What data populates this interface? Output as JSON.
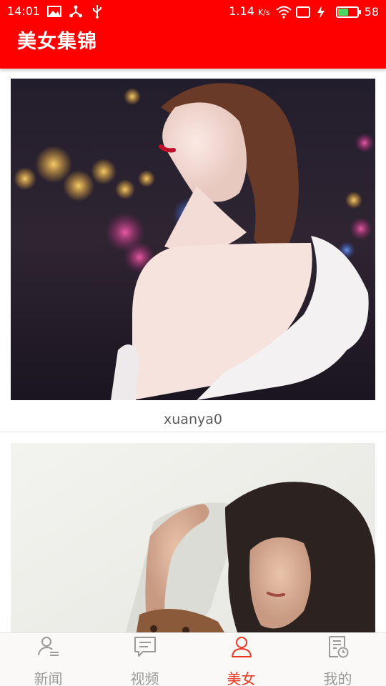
{
  "status_bar": {
    "time": "14:01",
    "net_speed": "1.14",
    "net_speed_unit": "K/s",
    "battery_level": "58",
    "battery_fraction": 0.58,
    "icons": [
      "gallery-icon",
      "usb-share-icon",
      "usb-icon",
      "wifi-icon",
      "screen-icon",
      "charging-icon",
      "battery-icon"
    ]
  },
  "app_bar": {
    "title": "美女集锦"
  },
  "feed": {
    "items": [
      {
        "caption": "xuanya0"
      },
      {
        "caption": ""
      }
    ]
  },
  "bottom_nav": {
    "items": [
      {
        "label": "新闻",
        "icon": "user-list-icon"
      },
      {
        "label": "视频",
        "icon": "chat-bubble-icon"
      },
      {
        "label": "美女",
        "icon": "person-icon"
      },
      {
        "label": "我的",
        "icon": "history-doc-icon"
      }
    ],
    "active_index": 2
  },
  "colors": {
    "primary": "#ff0000",
    "active_tab": "#e8371f",
    "inactive_tab": "#9a9a9a",
    "caption_text": "#5a5a5a"
  }
}
